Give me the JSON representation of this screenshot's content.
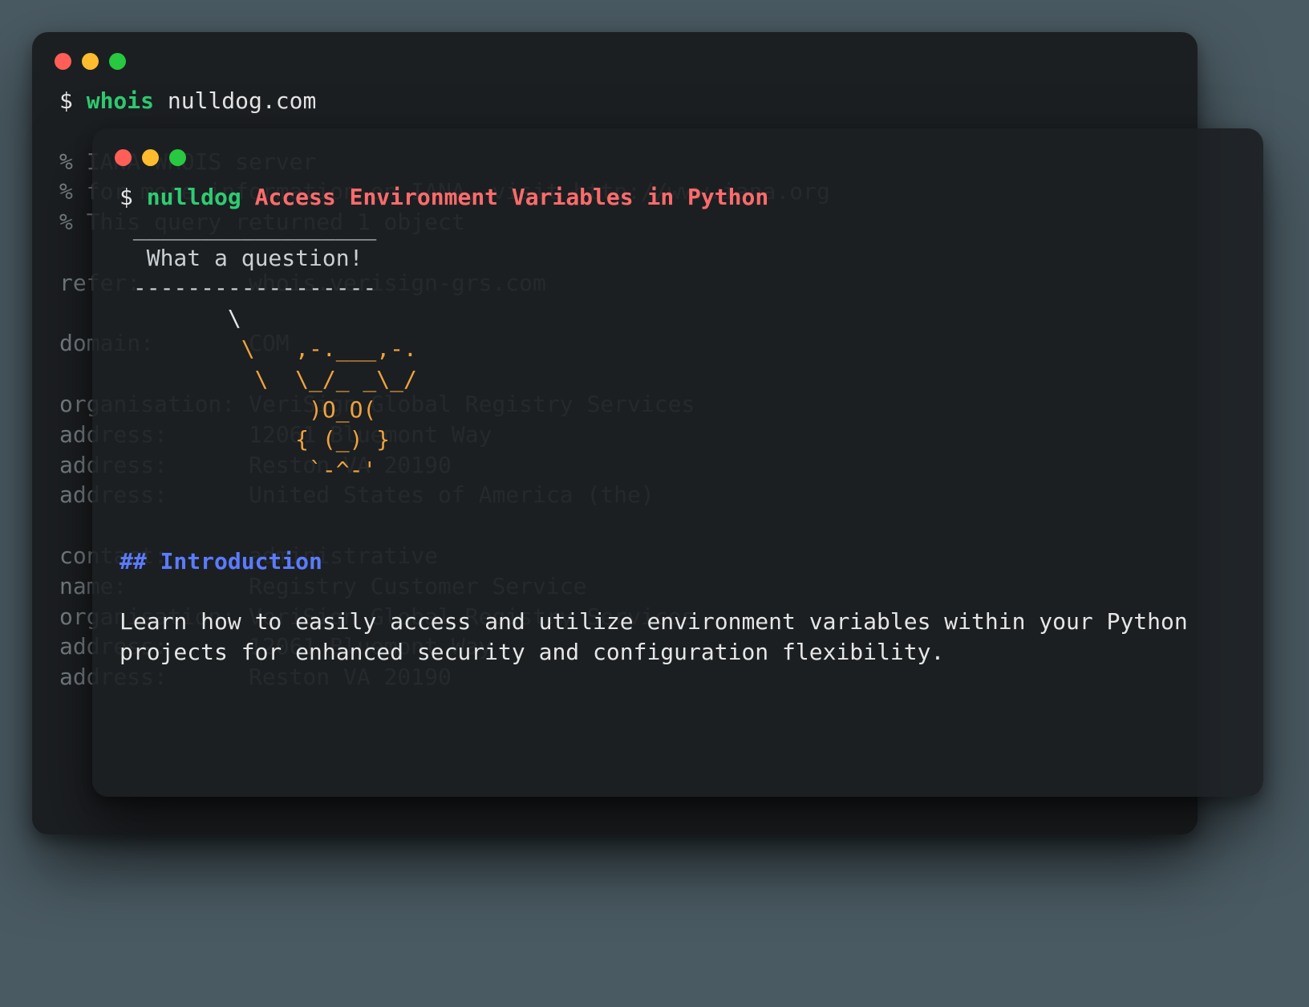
{
  "back": {
    "prompt": "$ ",
    "command": "whois",
    "arg": "nulldog.com",
    "lines": [
      "% IANA WHOIS server",
      "% for more information on IANA, visit http://www.iana.org",
      "% This query returned 1 object",
      "",
      "refer:        whois.verisign-grs.com",
      "",
      "domain:       COM",
      "",
      "organisation: VeriSign Global Registry Services",
      "address:      12061 Bluemont Way",
      "address:      Reston VA 20190",
      "address:      United States of America (the)",
      "",
      "contact:      administrative",
      "name:         Registry Customer Service",
      "organisation: VeriSign Global Registry Services",
      "address:      12061 Bluemont Way",
      "address:      Reston VA 20190"
    ]
  },
  "front": {
    "prompt": "$ ",
    "command": "nulldog",
    "arg": "Access Environment Variables in Python",
    "bubble_top": " __________________",
    "bubble_mid": "  What a question!",
    "bubble_bottom": " ------------------",
    "cow": [
      "        \\",
      "         \\   ,-.___,-.",
      "          \\  \\_/_ _\\_/",
      "              )O_O(",
      "             { (_) }",
      "              `-^-'"
    ],
    "heading": "## Introduction",
    "paragraph": "Learn how to easily access and utilize environment variables within your Python projects for enhanced security and configuration flexibility."
  }
}
